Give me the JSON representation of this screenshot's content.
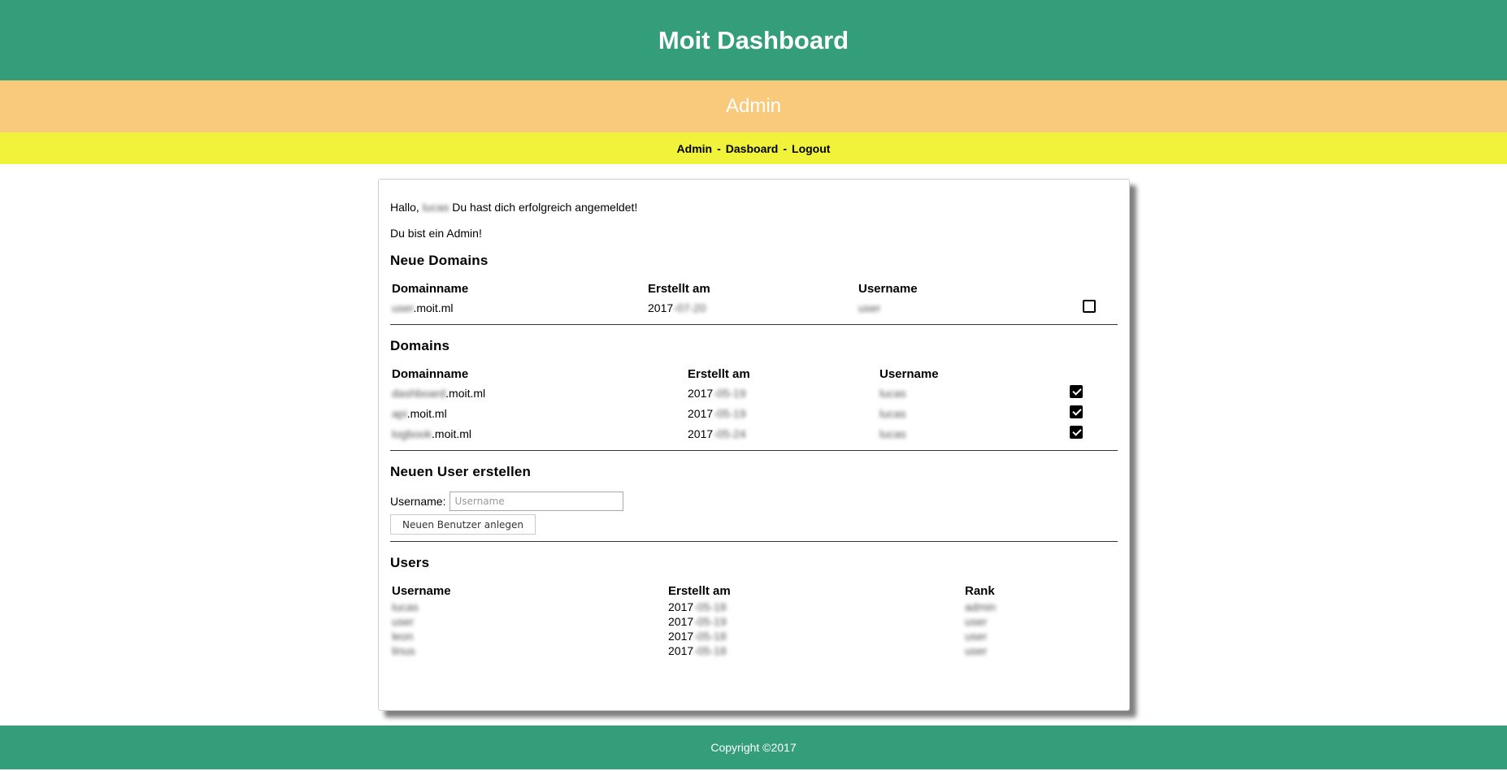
{
  "header": {
    "title": "Moit Dashboard",
    "subtitle": "Admin"
  },
  "nav": {
    "items": [
      "Admin",
      "Dasboard",
      "Logout"
    ],
    "separator": "-"
  },
  "greeting": {
    "prefix": "Hallo,",
    "name": "lucas",
    "suffix": "Du hast dich erfolgreich angemeldet!",
    "admin_note": "Du bist ein Admin!"
  },
  "new_domains": {
    "title": "Neue Domains",
    "headers": [
      "Domainname",
      "Erstellt am",
      "Username"
    ],
    "rows": [
      {
        "sub": "user",
        "domain": ".moit.ml",
        "year": "2017",
        "date_rest": "-07-20",
        "username": "user",
        "checked": false
      }
    ]
  },
  "domains": {
    "title": "Domains",
    "headers": [
      "Domainname",
      "Erstellt am",
      "Username"
    ],
    "rows": [
      {
        "sub": "dashboard",
        "domain": ".moit.ml",
        "year": "2017",
        "date_rest": "-05-19",
        "username": "lucas",
        "checked": true
      },
      {
        "sub": "api",
        "domain": ".moit.ml",
        "year": "2017",
        "date_rest": "-05-19",
        "username": "lucas",
        "checked": true
      },
      {
        "sub": "logbook",
        "domain": ".moit.ml",
        "year": "2017",
        "date_rest": "-05-24",
        "username": "lucas",
        "checked": true
      }
    ]
  },
  "create_user": {
    "title": "Neuen User erstellen",
    "label": "Username:",
    "placeholder": "Username",
    "value": "",
    "button": "Neuen Benutzer anlegen"
  },
  "users": {
    "title": "Users",
    "headers": [
      "Username",
      "Erstellt am",
      "Rank"
    ],
    "rows": [
      {
        "username": "lucas",
        "year": "2017",
        "date_rest": "-05-18",
        "rank": "admin"
      },
      {
        "username": "user",
        "year": "2017",
        "date_rest": "-05-19",
        "rank": "user"
      },
      {
        "username": "leon",
        "year": "2017",
        "date_rest": "-05-18",
        "rank": "user"
      },
      {
        "username": "linus",
        "year": "2017",
        "date_rest": "-05-18",
        "rank": "user"
      }
    ]
  },
  "footer": {
    "text": "Copyright ©2017"
  },
  "colors": {
    "header": "#339e79",
    "subheader": "#f9c97c",
    "nav": "#f0f33a",
    "footer": "#339e79"
  }
}
